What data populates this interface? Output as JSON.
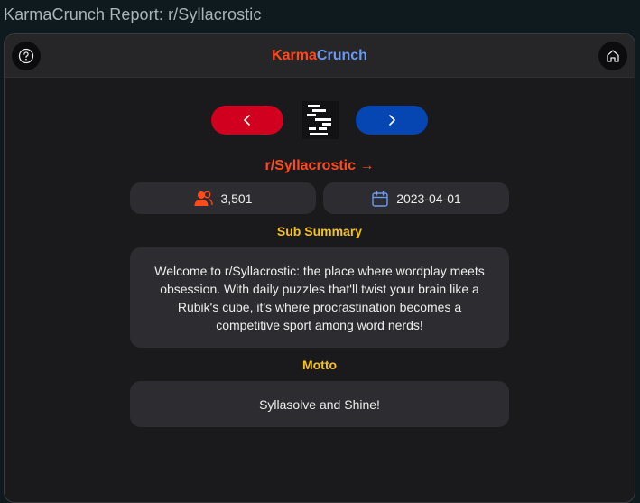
{
  "page": {
    "title": "KarmaCrunch Report: r/Syllacrostic"
  },
  "header": {
    "brand_part1": "Karma",
    "brand_part2": "Crunch"
  },
  "nav": {
    "subreddit_link": "r/Syllacrostic →"
  },
  "stats": {
    "members": "3,501",
    "created": "2023-04-01"
  },
  "summary": {
    "heading": "Sub Summary",
    "text": "Welcome to r/Syllacrostic: the place where wordplay meets obsession. With daily puzzles that'll twist your brain like a Rubik's cube, it's where procrastination becomes a competitive sport among word nerds!"
  },
  "motto": {
    "heading": "Motto",
    "text": "Syllasolve and Shine!"
  },
  "colors": {
    "brand_orange": "#ff4a1c",
    "brand_blue": "#6b9bf0",
    "prev_button": "#d0001e",
    "next_button": "#0646b3",
    "heading_yellow": "#f3c31b"
  },
  "icons": {
    "help": "question-circle-icon",
    "home": "home-icon",
    "prev": "chevron-left-icon",
    "next": "chevron-right-icon",
    "members": "users-icon",
    "created": "calendar-icon"
  }
}
